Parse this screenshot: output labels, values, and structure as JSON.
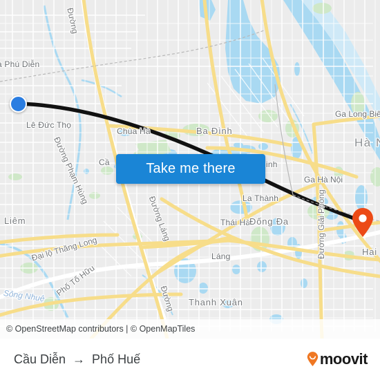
{
  "map": {
    "attribution": "© OpenStreetMap contributors | © OpenMapTiles",
    "colors": {
      "land": "#ececec",
      "water": "#a9d9f2",
      "park": "#cfe8c8",
      "road_major": "#f7dd8a",
      "road_minor": "#ffffff",
      "route_line": "#111111",
      "origin_marker": "#2a7de1",
      "destination_marker": "#ec4a16",
      "cta_blue": "#1a85d6",
      "label_text": "#6b6f72"
    },
    "labels": [
      {
        "text": "a Phú Diễn",
        "kind": "place"
      },
      {
        "text": "Lê Đức Thọ",
        "kind": "place"
      },
      {
        "text": "Đường",
        "kind": "road"
      },
      {
        "text": "Chùa Hà",
        "kind": "place"
      },
      {
        "text": "Ba Đình",
        "kind": "district"
      },
      {
        "text": "Ga Long Biên",
        "kind": "station"
      },
      {
        "text": "Hà N",
        "kind": "city"
      },
      {
        "text": "Đường Phạm Hùng",
        "kind": "road"
      },
      {
        "text": "Cầ",
        "kind": "place"
      },
      {
        "text": "inh",
        "kind": "place"
      },
      {
        "text": "Ga Hà Nội",
        "kind": "station"
      },
      {
        "text": "Liêm",
        "kind": "district"
      },
      {
        "text": "Đường Láng",
        "kind": "road"
      },
      {
        "text": "La Thành",
        "kind": "place"
      },
      {
        "text": "Thái Hà",
        "kind": "place"
      },
      {
        "text": "Đống Đa",
        "kind": "district"
      },
      {
        "text": "Đại lộ Thăng Long",
        "kind": "road"
      },
      {
        "text": "Láng",
        "kind": "place"
      },
      {
        "text": "Hai B",
        "kind": "district"
      },
      {
        "text": "Sông Nhuệ",
        "kind": "water"
      },
      {
        "text": "Phố Tố Hữu",
        "kind": "road"
      },
      {
        "text": "Đường",
        "kind": "road"
      },
      {
        "text": "Thanh Xuân",
        "kind": "district"
      },
      {
        "text": "Đường Giải Phóng",
        "kind": "road"
      }
    ],
    "markers": {
      "origin": {
        "name": "origin-marker",
        "shape": "circle-dot"
      },
      "destination": {
        "name": "destination-marker",
        "shape": "map-pin"
      }
    }
  },
  "cta": {
    "label": "Take me there"
  },
  "footer": {
    "origin": "Cầu Diễn",
    "arrow": "→",
    "destination": "Phố Huế",
    "brand": "moovit"
  }
}
